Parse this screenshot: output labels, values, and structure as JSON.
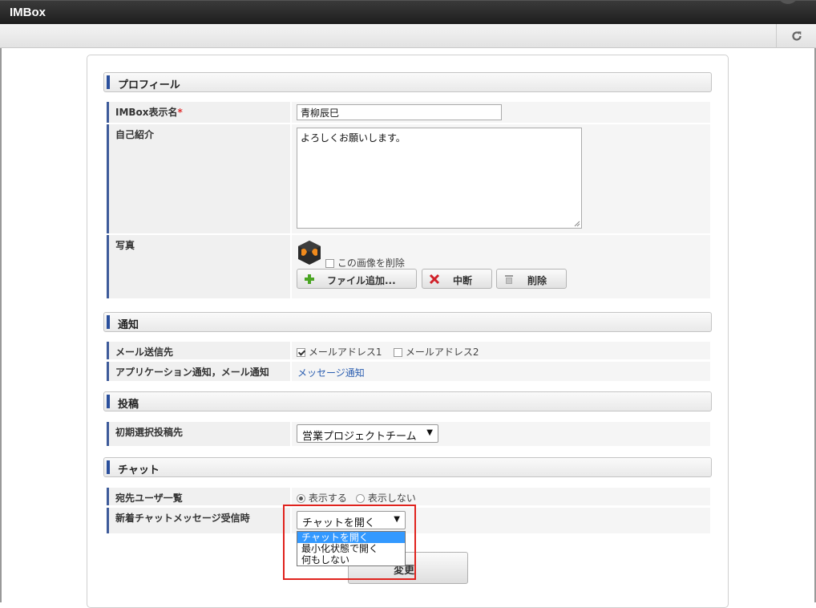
{
  "app": {
    "title": "IMBox"
  },
  "toolbar": {
    "refresh_icon": "refresh-icon"
  },
  "sections": {
    "profile": "プロフィール",
    "notification": "通知",
    "post": "投稿",
    "chat": "チャット"
  },
  "profile": {
    "display_name_label": "IMBox表示名",
    "required_mark": "*",
    "display_name_value": "青柳辰巳",
    "intro_label": "自己紹介",
    "intro_value": "よろしくお願いします。",
    "photo_label": "写真",
    "delete_image_label": "この画像を削除",
    "buttons": {
      "add_file": "ファイル追加...",
      "cancel": "中断",
      "delete": "削除"
    }
  },
  "notification": {
    "mail_label": "メール送信先",
    "mail_address_1": "メールアドレス1",
    "mail_address_2": "メールアドレス2",
    "mail_address_1_checked": true,
    "mail_address_2_checked": false,
    "app_mail_label": "アプリケーション通知，メール通知",
    "app_mail_link": "メッセージ通知"
  },
  "post": {
    "default_target_label": "初期選択投稿先",
    "default_target_value": "営業プロジェクトチーム"
  },
  "chat": {
    "user_list_label": "宛先ユーザ一覧",
    "show_label": "表示する",
    "hide_label": "表示しない",
    "selected": "show",
    "new_message_label": "新着チャットメッセージ受信時",
    "new_message_value": "チャットを開く",
    "options": [
      "チャットを開く",
      "最小化状態で開く",
      "何もしない"
    ]
  },
  "submit": {
    "label": "変更"
  },
  "colors": {
    "accent": "#2a4f9c",
    "highlight": "#e0231e",
    "selected_option": "#3399ff"
  }
}
